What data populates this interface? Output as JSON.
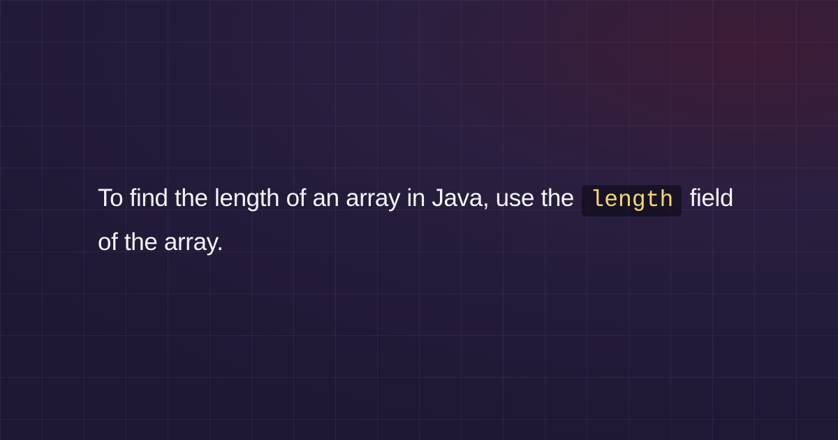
{
  "main": {
    "text_before": "To find the length of an array in Java, use the ",
    "code_token": "length",
    "text_after": " field of the array."
  },
  "colors": {
    "code_highlight": "#f5d76e",
    "text": "#f5f5f7"
  }
}
